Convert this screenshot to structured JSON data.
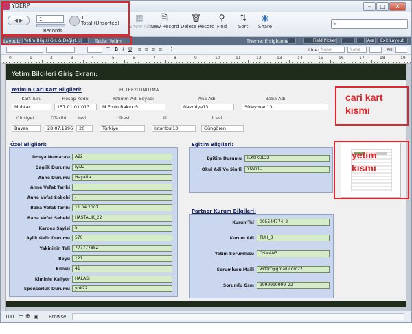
{
  "window": {
    "title": "YDERP"
  },
  "toolbar": {
    "record_number": "1",
    "record_count": "1",
    "found_status": "Total (Unsorted)",
    "records_label": "Records",
    "show_all_label": "Show All",
    "new_record_label": "New Record",
    "delete_record_label": "Delete Record",
    "find_label": "Find",
    "sort_label": "Sort",
    "share_label": "Share",
    "search_placeholder": ""
  },
  "layoutbar": {
    "layout_label": "Layout:",
    "layout_value": "Yetim Bilgisi Gir. & Değişt...",
    "table_label": "Table: Yetim",
    "theme_label": "Theme: Enlightened",
    "field_picker_label": "Field Picker",
    "exit_layout_label": "Exit Layout",
    "aa_label": "Aæ"
  },
  "formatbar": {
    "line_label": "Line:",
    "line_value": "None",
    "none_value": "None",
    "fill_label": "Fill:"
  },
  "ruler": {
    "numbers": [
      "0",
      "1",
      "2",
      "3",
      "4",
      "5",
      "6",
      "7",
      "8",
      "9",
      "10",
      "11",
      "12",
      "13",
      "14",
      "15",
      "16",
      "17",
      "18",
      "19"
    ]
  },
  "form": {
    "title": "Yetim Bilgileri Giriş Ekranı:",
    "cari_section_title": "Yetimin Cari Kart Bilgileri:",
    "filter_label": "FILTREYI UNUTMA",
    "cari_headers_row1": [
      "Kart Turu",
      "Hesap Kodu",
      "Yetimin Adı Soyadı",
      "Ana Adi",
      "Baba Adi"
    ],
    "cari_values_row1": [
      "Muhtaç",
      "157.01.01.013",
      "M.Emin Bakırcı5",
      "Nazmiye13",
      "Süleyman13"
    ],
    "cari_headers_row2": [
      "Cinsiyet",
      "DTarihi",
      "Yasi",
      "Ulkesi",
      "Ili",
      "Ilcesi"
    ],
    "cari_values_row2": [
      "Bayan",
      "28.07.1996",
      "26",
      "Türkiye",
      "Istanbul13",
      "Güngören"
    ],
    "ozel_section_title": "Özel Bilgileri:",
    "ozel_labels": [
      "Dosya Numarası",
      "Saglik Durumu",
      "Anne Durumu",
      "Anne Vefat Tarihi",
      "Anne Vefat Sebebi",
      "Baba Vefat Tarihi",
      "Baba Vefat Sebebi",
      "Kardes Sayisi",
      "Aylik Gelir Durumu",
      "Yakininin Teli",
      "Boyu",
      "Kilosu",
      "Kiminle Kaliyor",
      "Sponsorluk Durumu"
    ],
    "ozel_values": [
      "A22",
      "iyi22",
      "Hayatta",
      "-",
      "-",
      "11.04.2007",
      "HASTALIK_22",
      "5",
      "570",
      "777777882",
      "121",
      "41",
      "HALASI",
      "yok22"
    ],
    "egitim_section_title": "Eğitim Bilgileri:",
    "egitim_labels": [
      "Egitim Durumu",
      "Okul Adi Ve Sinifi"
    ],
    "egitim_values": [
      "İLKOKUL22",
      "YÜZYIL"
    ],
    "partner_section_title": "Partner Kurum Bilgileri:",
    "partner_labels": [
      "KurumTel",
      "Kurum Adi",
      "Yetim Sorumlusu",
      "Sorumlusu Maili",
      "Sorumlu Gsm"
    ],
    "partner_values": [
      "005544774_2",
      "TUH_3",
      "OSMAN3",
      "wrtzrt@gmail.com22",
      "9999999999_22"
    ]
  },
  "annotations": {
    "cari_kart": [
      "cari kart",
      "kısmı"
    ],
    "yetim": [
      "yetim",
      "kısmı"
    ]
  },
  "statusbar": {
    "zoom": "100",
    "mode": "Browse"
  },
  "colors": {
    "annotation_red": "#e2242c",
    "header_band": "#1f2b1b",
    "panel_blue": "#cad7ef",
    "field_green": "#d6ecc8"
  }
}
